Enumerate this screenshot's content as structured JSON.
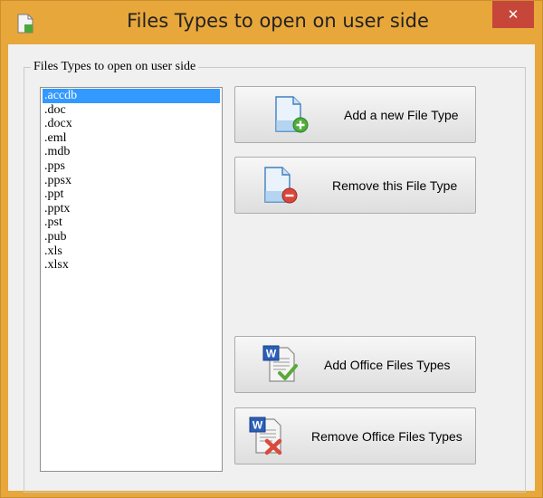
{
  "window": {
    "title": "Files Types to open on user side",
    "close_glyph": "✕",
    "icon": "file-icon"
  },
  "group": {
    "label": "Files Types to open on user side"
  },
  "file_types": [
    ".accdb",
    ".doc",
    ".docx",
    ".eml",
    ".mdb",
    ".pps",
    ".ppsx",
    ".ppt",
    ".pptx",
    ".pst",
    ".pub",
    ".xls",
    ".xlsx"
  ],
  "selected_index": 0,
  "buttons": {
    "add_type": "Add a new File Type",
    "remove_type": "Remove this File Type",
    "add_office": "Add Office Files Types",
    "remove_office": "Remove Office Files Types"
  },
  "colors": {
    "title_bar": "#e8a73a",
    "close_button": "#c7463a",
    "selection": "#3399ff"
  }
}
